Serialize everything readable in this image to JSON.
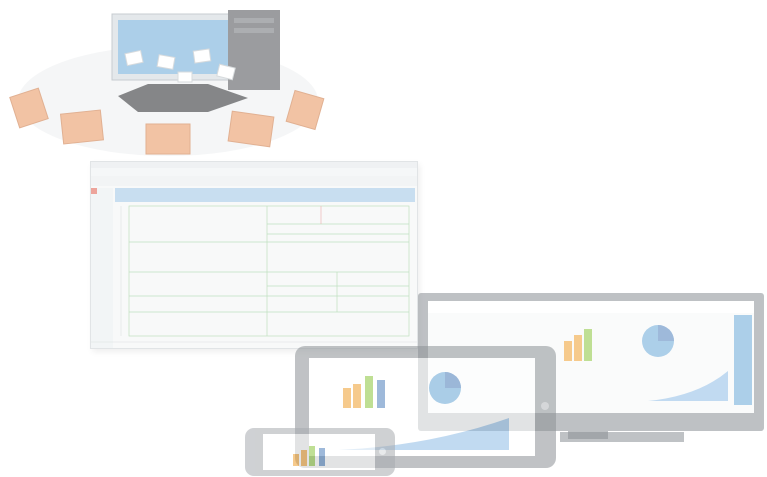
{
  "scene": {
    "accent": "#5b9bd5",
    "folder_color": "#e8935a",
    "chart_orange": "#f0a030",
    "chart_green": "#8cc63e",
    "chart_blue": "#4f81bd",
    "icons": [
      "server-icon",
      "monitor-icon",
      "folder-icon",
      "document-icon",
      "tablet-icon",
      "phone-icon",
      "pie-chart-icon",
      "bar-chart-icon",
      "area-chart-icon"
    ]
  }
}
